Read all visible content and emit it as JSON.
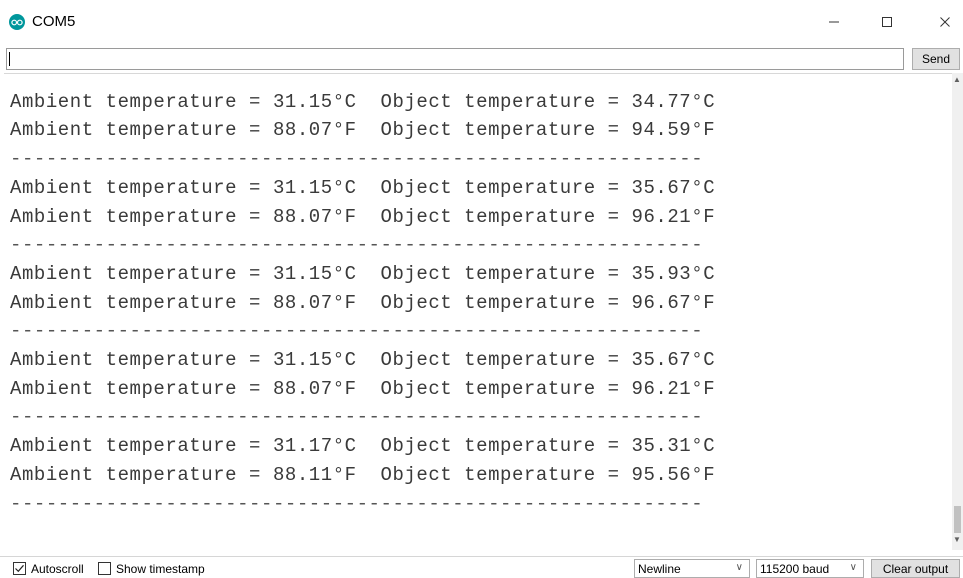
{
  "window": {
    "title": "COM5",
    "app_icon": "arduino-logo-icon",
    "controls": {
      "minimize": "—",
      "maximize": "☐",
      "close": "✕"
    }
  },
  "send_bar": {
    "input_value": "",
    "send_label": "Send"
  },
  "serial_output": {
    "lines": [
      "----------------------------------------------------------",
      "Ambient temperature = 31.15°C  Object temperature = 34.77°C",
      "Ambient temperature = 88.07°F  Object temperature = 94.59°F",
      "----------------------------------------------------------",
      "Ambient temperature = 31.15°C  Object temperature = 35.67°C",
      "Ambient temperature = 88.07°F  Object temperature = 96.21°F",
      "----------------------------------------------------------",
      "Ambient temperature = 31.15°C  Object temperature = 35.93°C",
      "Ambient temperature = 88.07°F  Object temperature = 96.67°F",
      "----------------------------------------------------------",
      "Ambient temperature = 31.15°C  Object temperature = 35.67°C",
      "Ambient temperature = 88.07°F  Object temperature = 96.21°F",
      "----------------------------------------------------------",
      "Ambient temperature = 31.17°C  Object temperature = 35.31°C",
      "Ambient temperature = 88.11°F  Object temperature = 95.56°F",
      "----------------------------------------------------------"
    ]
  },
  "status_bar": {
    "autoscroll_label": "Autoscroll",
    "autoscroll_checked": true,
    "timestamp_label": "Show timestamp",
    "timestamp_checked": false,
    "line_ending": "Newline",
    "baud_rate": "115200 baud",
    "clear_label": "Clear output"
  },
  "colors": {
    "arduino_teal": "#00979c",
    "text": "#3a3a3a"
  }
}
